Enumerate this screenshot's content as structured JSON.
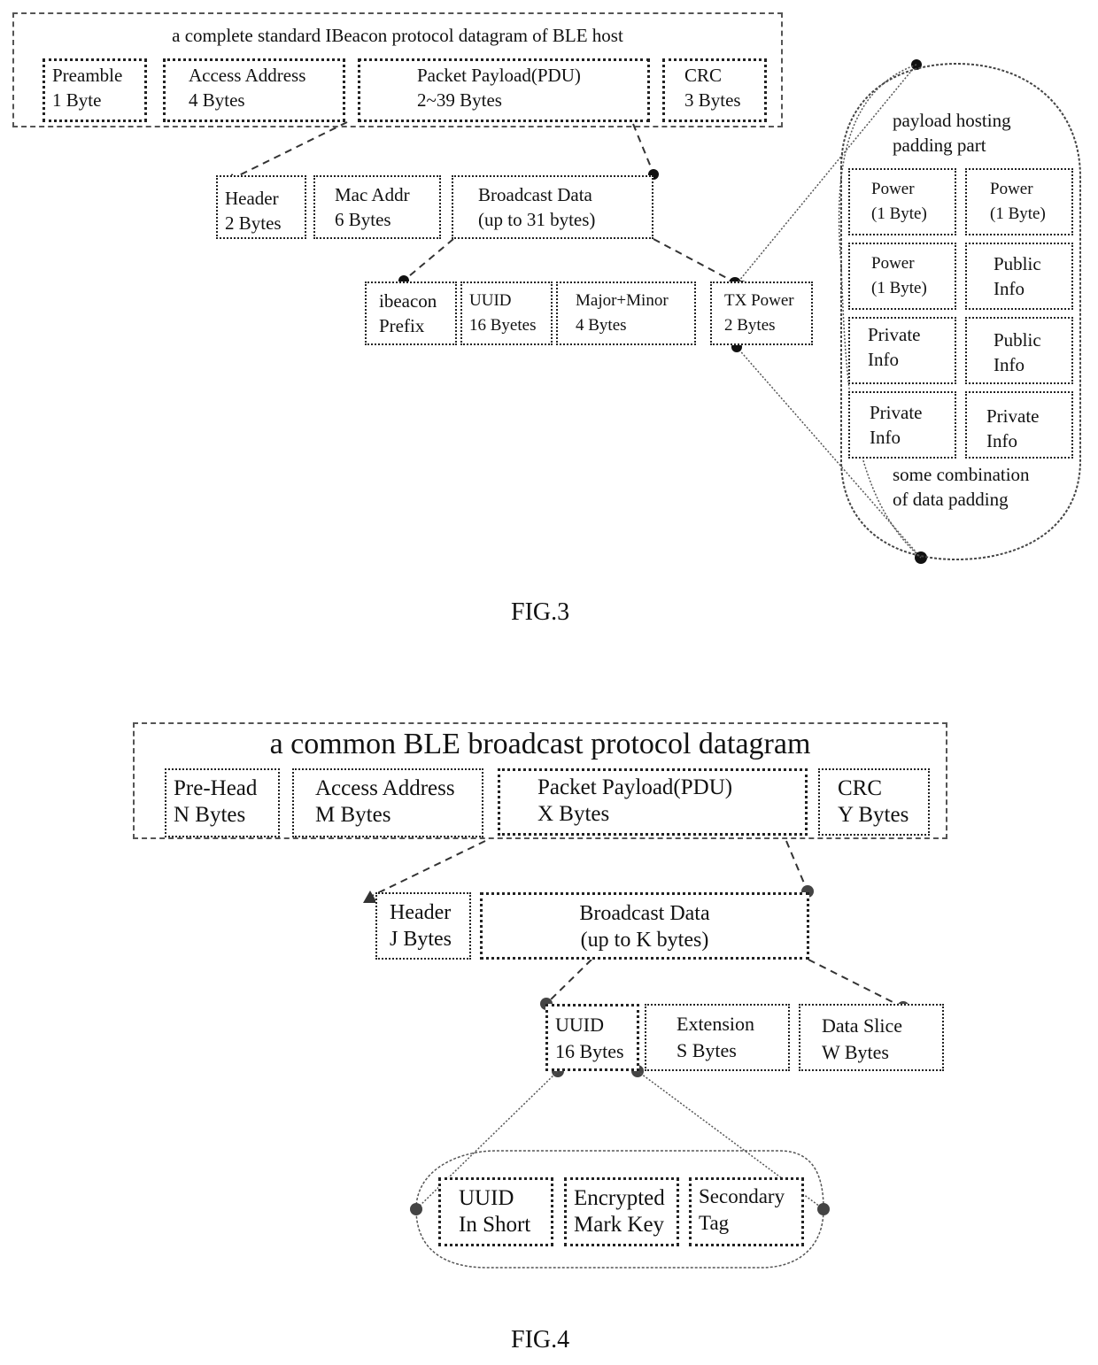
{
  "fig3": {
    "caption": "FIG.3",
    "datagram_title": "a complete standard IBeacon protocol datagram of BLE host",
    "top_fields": [
      {
        "name": "Preamble",
        "size": "1 Byte"
      },
      {
        "name": "Access Address",
        "size": "4 Bytes"
      },
      {
        "name": "Packet Payload(PDU)",
        "size": "2~39 Bytes"
      },
      {
        "name": "CRC",
        "size": "3 Bytes"
      }
    ],
    "pdu_fields": [
      {
        "name": "Header",
        "size": "2 Bytes"
      },
      {
        "name": "Mac Addr",
        "size": "6 Bytes"
      },
      {
        "name": "Broadcast Data",
        "size": "(up to 31 bytes)"
      }
    ],
    "broadcast_fields": [
      {
        "name": "ibeacon",
        "size": "Prefix"
      },
      {
        "name": "UUID",
        "size": "16 Byetes"
      },
      {
        "name": "Major+Minor",
        "size": "4 Bytes"
      },
      {
        "name": "TX Power",
        "size": "2 Bytes"
      }
    ],
    "padding": {
      "title_line1": "payload hosting",
      "title_line2": "padding part",
      "cells": [
        {
          "line1": "Power",
          "line2": "(1 Byte)"
        },
        {
          "line1": "Power",
          "line2": "(1 Byte)"
        },
        {
          "line1": "Power",
          "line2": "(1 Byte)"
        },
        {
          "line1": "Public",
          "line2": "Info"
        },
        {
          "line1": "Private",
          "line2": "Info"
        },
        {
          "line1": "Public",
          "line2": "Info"
        },
        {
          "line1": "Private",
          "line2": "Info"
        },
        {
          "line1": "Private",
          "line2": "Info"
        }
      ],
      "footer_line1": "some combination",
      "footer_line2": "of data padding"
    }
  },
  "fig4": {
    "caption": "FIG.4",
    "datagram_title": "a common BLE broadcast protocol datagram",
    "top_fields": [
      {
        "name": "Pre-Head",
        "size": "N Bytes"
      },
      {
        "name": "Access Address",
        "size": "M Bytes"
      },
      {
        "name": "Packet Payload(PDU)",
        "size": "X Bytes"
      },
      {
        "name": "CRC",
        "size": "Y Bytes"
      }
    ],
    "pdu_fields": [
      {
        "name": "Header",
        "size": "J Bytes"
      },
      {
        "name": "Broadcast Data",
        "size": "(up to K bytes)"
      }
    ],
    "broadcast_fields": [
      {
        "name": "UUID",
        "size": "16 Bytes"
      },
      {
        "name": "Extension",
        "size": "S Bytes"
      },
      {
        "name": "Data Slice",
        "size": "W Bytes"
      }
    ],
    "uuid_parts": [
      {
        "line1": "UUID",
        "line2": "In Short"
      },
      {
        "line1": "Encrypted",
        "line2": "Mark Key"
      },
      {
        "line1": "Secondary",
        "line2": "Tag"
      }
    ]
  }
}
